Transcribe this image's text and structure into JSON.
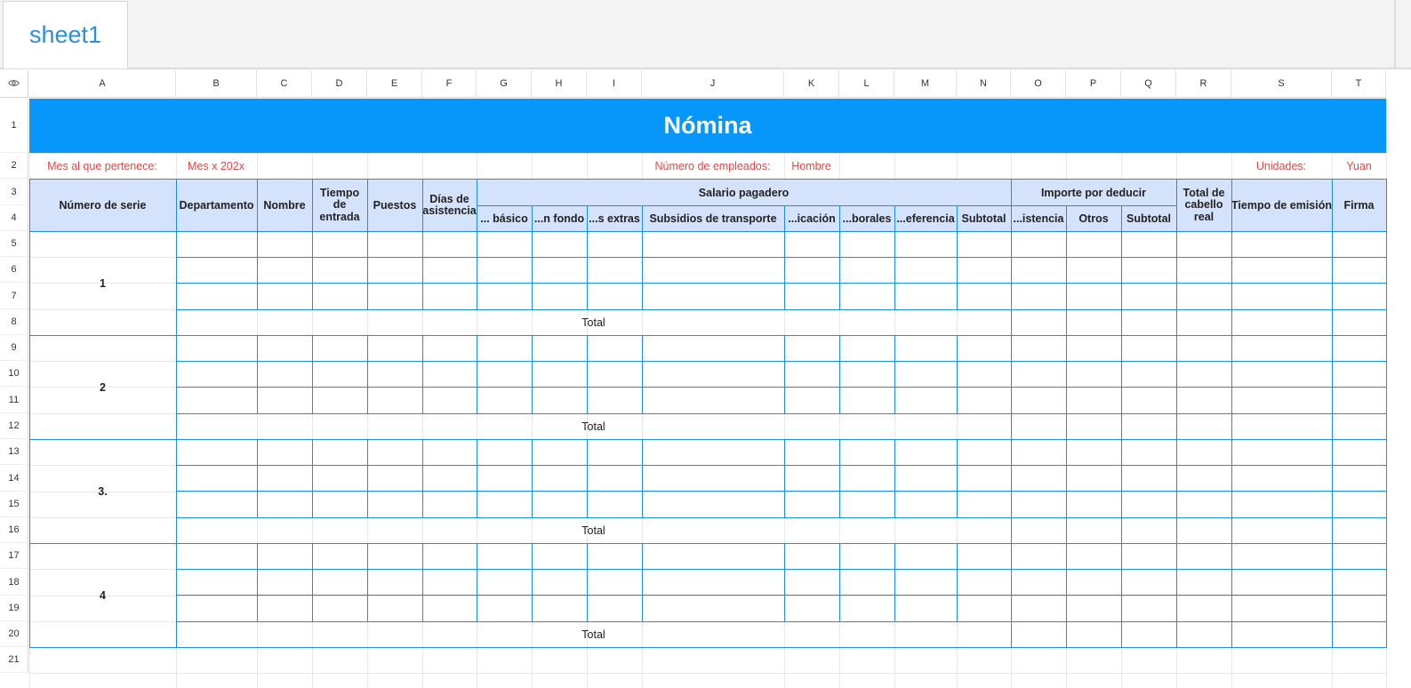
{
  "sheet": {
    "tab_label": "sheet1"
  },
  "columns": [
    "A",
    "B",
    "C",
    "D",
    "E",
    "F",
    "G",
    "H",
    "I",
    "J",
    "K",
    "L",
    "M",
    "N",
    "O",
    "P",
    "Q",
    "R",
    "S",
    "T"
  ],
  "rows": [
    "1",
    "2",
    "3",
    "4",
    "5",
    "6",
    "7",
    "8",
    "9",
    "10",
    "11",
    "12",
    "13",
    "14",
    "15",
    "16",
    "17",
    "18",
    "19",
    "20",
    "21"
  ],
  "title": "Nómina",
  "info": {
    "month_label": "Mes al que pertenece:",
    "month_value": "Mes x 202x",
    "employees_label": "Número de empleados:",
    "employees_value": "Hombre",
    "units_label": "Unidades:",
    "units_value": "Yuan"
  },
  "headers": {
    "serial": "Número de serie",
    "department": "Departamento",
    "name": "Nombre",
    "entry_time": "Tiempo de entrada",
    "positions": "Puestos",
    "attendance_days": "Días de asistencia",
    "salary_payable": "Salario pagadero",
    "basic": "... básico",
    "fund": "...n fondo",
    "extras": "...s extras",
    "transport": "Subsidios de transporte",
    "ication": "...icación",
    "borales": "...borales",
    "eferencia": "...eferencia",
    "subtotal1": "Subtotal",
    "deductions": "Importe por deducir",
    "istencia": "...istencia",
    "others": "Otros",
    "subtotal2": "Subtotal",
    "total_real": "Total de cabello real",
    "issue_time": "Tiempo de emisión",
    "signature": "Firma"
  },
  "groups": [
    {
      "serial": "1",
      "total_label": "Total"
    },
    {
      "serial": "2",
      "total_label": "Total"
    },
    {
      "serial": "3.",
      "total_label": "Total"
    },
    {
      "serial": "4",
      "total_label": "Total"
    }
  ],
  "colors": {
    "title_band": "#0797fb",
    "header_fill": "#d4e3fb",
    "border_blue": "#1e8fe0",
    "info_red": "#e04848",
    "tab_text": "#2a8fd8"
  },
  "icons": {
    "corner": "eye-icon"
  }
}
